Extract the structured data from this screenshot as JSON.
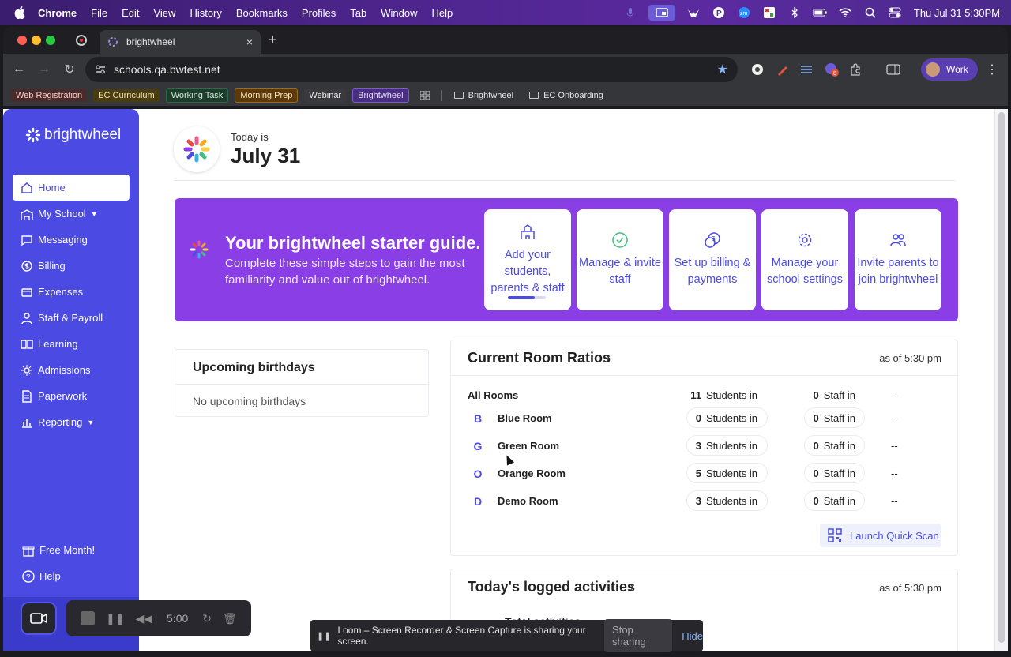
{
  "menubar": {
    "items": [
      "Chrome",
      "File",
      "Edit",
      "View",
      "History",
      "Bookmarks",
      "Profiles",
      "Tab",
      "Window",
      "Help"
    ],
    "clock": "Thu Jul 31  5:30PM"
  },
  "browser": {
    "tab_title": "brightwheel",
    "url": "schools.qa.bwtest.net",
    "profile": "Work",
    "extension_badge": "8",
    "bookmarks": [
      "Web Registration",
      "EC Curriculum",
      "Working Task",
      "Morning Prep",
      "Webinar",
      "Brightwheel"
    ],
    "folders": [
      "Brightwheel",
      "EC Onboarding"
    ]
  },
  "sidebar": {
    "logo": "brightwheel",
    "items": [
      {
        "label": "Home",
        "icon": "home-icon"
      },
      {
        "label": "My School",
        "icon": "school-icon"
      },
      {
        "label": "Messaging",
        "icon": "message-icon"
      },
      {
        "label": "Billing",
        "icon": "billing-icon"
      },
      {
        "label": "Expenses",
        "icon": "expenses-icon"
      },
      {
        "label": "Staff & Payroll",
        "icon": "staff-icon"
      },
      {
        "label": "Learning",
        "icon": "learning-icon"
      },
      {
        "label": "Admissions",
        "icon": "admissions-icon"
      },
      {
        "label": "Paperwork",
        "icon": "paperwork-icon"
      },
      {
        "label": "Reporting",
        "icon": "reporting-icon"
      }
    ],
    "bottom": {
      "free_month": "Free Month!",
      "help": "Help"
    }
  },
  "today": {
    "label": "Today is",
    "date": "July 31"
  },
  "starter": {
    "title": "Your brightwheel starter guide.",
    "desc": "Complete these simple steps to gain the most familiarity and value out of brightwheel.",
    "cards": [
      {
        "label": "Add your students, parents & staff",
        "icon": "building-icon",
        "progress": 0.7
      },
      {
        "label": "Manage & invite staff",
        "icon": "check-circle-icon"
      },
      {
        "label": "Set up billing & payments",
        "icon": "dollar-icon"
      },
      {
        "label": "Manage your school settings",
        "icon": "gear-icon"
      },
      {
        "label": "Invite parents to join brightwheel",
        "icon": "people-icon"
      }
    ]
  },
  "birthdays": {
    "title": "Upcoming birthdays",
    "empty": "No upcoming birthdays"
  },
  "ratios": {
    "title": "Current Room Ratios",
    "as_of": "as of 5:30 pm",
    "all": {
      "name": "All Rooms",
      "students": "11",
      "staff": "0",
      "ratio": "--"
    },
    "students_label": "Students in",
    "staff_label": "Staff in",
    "rooms": [
      {
        "letter": "B",
        "name": "Blue Room",
        "students": "0",
        "staff": "0",
        "ratio": "--"
      },
      {
        "letter": "G",
        "name": "Green Room",
        "students": "3",
        "staff": "0",
        "ratio": "--"
      },
      {
        "letter": "O",
        "name": "Orange Room",
        "students": "5",
        "staff": "0",
        "ratio": "--"
      },
      {
        "letter": "D",
        "name": "Demo Room",
        "students": "3",
        "staff": "0",
        "ratio": "--"
      }
    ],
    "quick_scan": "Launch Quick Scan"
  },
  "logged": {
    "title": "Today's logged activities",
    "as_of": "as of 5:30 pm",
    "sub": "Total activities"
  },
  "loom": {
    "timer": "5:00",
    "share_msg": "Loom – Screen Recorder & Screen Capture is sharing your screen.",
    "stop": "Stop sharing",
    "hide": "Hide"
  },
  "colors": {
    "brand": "#4b4be4",
    "banner": "#8a3ee6"
  }
}
